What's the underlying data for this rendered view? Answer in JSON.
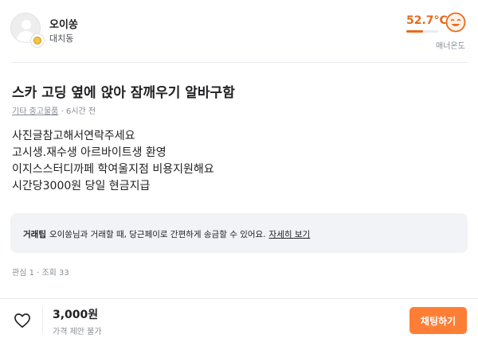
{
  "seller": {
    "nickname": "오이쏭",
    "region": "대치동",
    "temperature": "52.7°C",
    "temperature_fraction": 0.527,
    "temperature_label": "매너온도",
    "temperature_icon": "happy-face-icon"
  },
  "post": {
    "title": "스카 고딩 옆에 앉아 잠깨우기 알바구함",
    "category": "기타 중고물품",
    "meta_separator": "·",
    "time_ago": "6시간 전",
    "description": [
      "사진글참고해서연락주세요",
      "고시생.재수생 아르바이트생 환영",
      "이지스스터디까페 학여울지점 비용지원해요",
      "시간당3000원 당일 현금지급"
    ]
  },
  "tip": {
    "key": "거래팁",
    "text": "오이쏭님과 거래할 때, 당근페이로 간편하게 송금할 수 있어요.",
    "link": "자세히 보기"
  },
  "counts": "관심 1 · 조회 33",
  "bottom": {
    "heart_icon": "heart-outline-icon",
    "price": "3,000원",
    "price_note": "가격 제안 불가",
    "chat_button": "채팅하기"
  },
  "colors": {
    "accent": "#ff7e36",
    "temperature": "#e86a1e",
    "tip_background": "#f2f3f6"
  }
}
